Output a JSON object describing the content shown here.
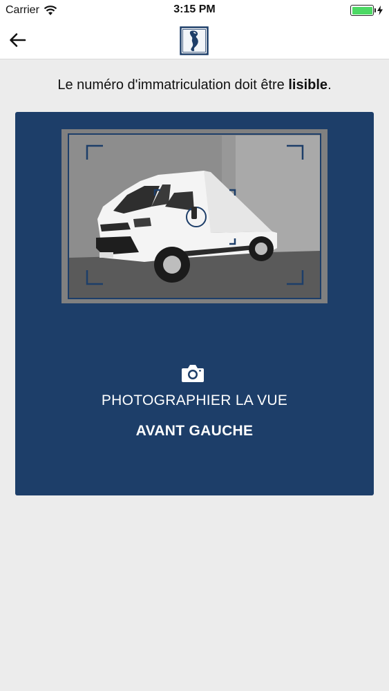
{
  "status_bar": {
    "carrier": "Carrier",
    "time": "3:15 PM",
    "battery_level": 1.0
  },
  "nav": {
    "back_icon": "arrow-left-icon",
    "logo_icon": "seahorse-logo-icon"
  },
  "instruction": {
    "text_before": "Le numéro d'immatriculation doit être ",
    "text_bold": "lisible",
    "text_after": "."
  },
  "capture_card": {
    "camera_icon": "camera-icon",
    "line1": "PHOTOGRAPHIER LA VUE",
    "line2": "AVANT GAUCHE"
  },
  "colors": {
    "card_background": "#1d3e69",
    "page_background": "#ececec",
    "battery_green": "#4cd964"
  }
}
